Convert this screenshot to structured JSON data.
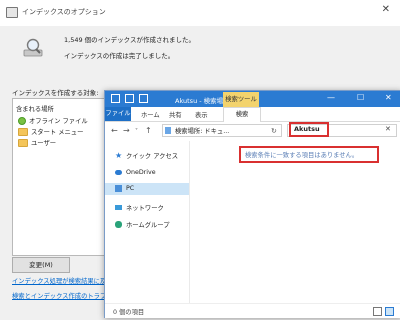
{
  "indexing_window": {
    "title": "インデックスのオプション",
    "close_glyph": "✕",
    "count_line": "1,549 個のインデックスが作成されました。",
    "status_line": "インデックスの作成は完了しました。",
    "locations_label": "インデックスを作成する対象:",
    "list_header": "含まれる場所",
    "locations": [
      "オフライン ファイル",
      "スタート メニュー",
      "ユーザー"
    ],
    "change_button": "変更(M)",
    "link_troubleshoot_search": "インデックス処理が検索結果に及ぼす",
    "link_troubleshoot_index": "検索とインデックス作成のトラブルシュ"
  },
  "explorer_window": {
    "title": "Akutsu - 検索場所",
    "context_tab_group": "検索ツール",
    "controls": [
      "—",
      "☐",
      "✕"
    ],
    "ribbon_tabs": [
      "ファイル",
      "ホーム",
      "共有",
      "表示",
      "検索"
    ],
    "address": "検索場所: ドキュ...",
    "search_query": "Akutsu",
    "nav_items": [
      "クイック アクセス",
      "OneDrive",
      "PC",
      "ネットワーク",
      "ホームグループ"
    ],
    "empty_message": "検索条件に一致する項目はありません。",
    "status_text": "0 個の項目"
  },
  "colors": {
    "title_blue": "#2b7bd2",
    "highlight_red": "#d93030",
    "context_yellow": "#f3d36d",
    "link_blue": "#0066cc"
  }
}
